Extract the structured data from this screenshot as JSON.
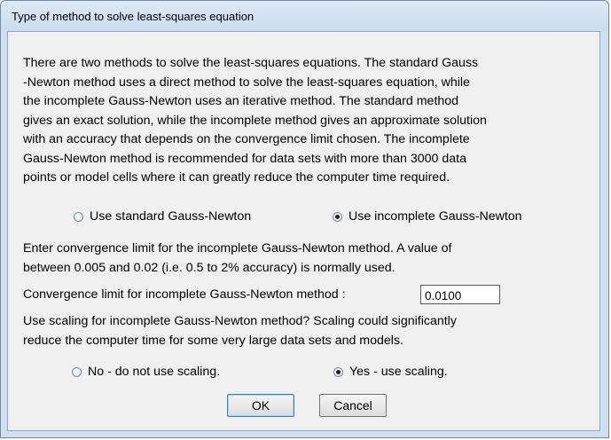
{
  "dialog": {
    "title": "Type of method to solve least-squares equation"
  },
  "description": "There are two methods to solve the least-squares equations. The standard Gauss\n-Newton method uses a direct method to solve the least-squares equation, while\nthe incomplete Gauss-Newton uses an iterative method. The standard method\ngives an exact solution, while the incomplete method gives an approximate solution\nwith an accuracy that depends on the convergence limit chosen. The incomplete\nGauss-Newton method is recommended for data sets with more than 3000 data\npoints or model cells where it can greatly reduce the computer time required.",
  "method_options": [
    {
      "label": "Use standard Gauss-Newton",
      "selected": false
    },
    {
      "label": "Use incomplete Gauss-Newton",
      "selected": true
    }
  ],
  "convergence": {
    "instruction_line1": "Enter convergence limit for the incomplete Gauss-Newton method.  A value of",
    "instruction_line2": "between 0.005 and 0.02 (i.e. 0.5 to 2% accuracy) is normally used.",
    "label": "Convergence limit for incomplete Gauss-Newton method :",
    "value": "0.0100"
  },
  "scaling": {
    "question_line1": "Use scaling for incomplete Gauss-Newton method? Scaling could significantly",
    "question_line2": "reduce the computer time for some very large data sets and models.",
    "options": [
      {
        "label": "No - do not use scaling.",
        "selected": false
      },
      {
        "label": "Yes - use scaling.",
        "selected": true
      }
    ]
  },
  "buttons": {
    "ok": "OK",
    "cancel": "Cancel"
  }
}
